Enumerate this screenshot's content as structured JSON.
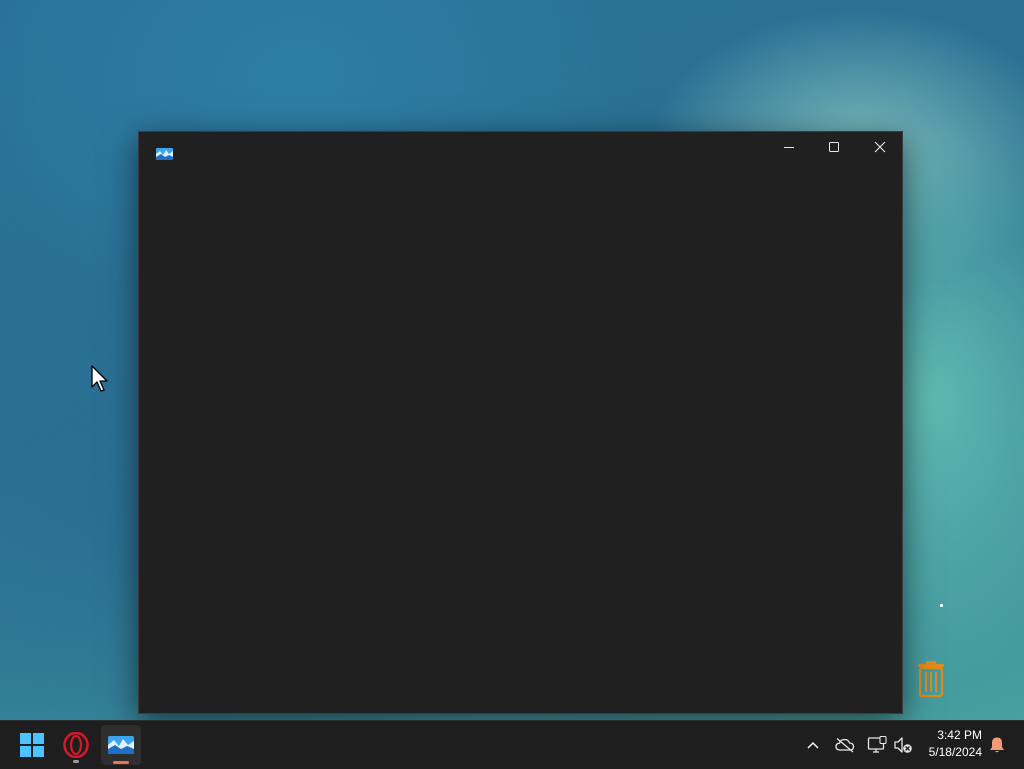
{
  "window": {
    "title": "",
    "app_icon": "photos-app-icon",
    "controls": {
      "minimize_icon": "minimize-icon",
      "maximize_icon": "maximize-icon",
      "close_icon": "close-icon"
    },
    "background": "#202020"
  },
  "desktop": {
    "icons": [
      "recycle-bin-icon"
    ]
  },
  "taskbar": {
    "pinned": [
      {
        "name": "start-button",
        "icon": "windows-logo-icon"
      },
      {
        "name": "opera-browser",
        "icon": "opera-icon"
      },
      {
        "name": "photos-app",
        "icon": "photos-app-icon",
        "active": true
      }
    ],
    "tray_icons": [
      "chevron-up-icon",
      "cloud-off-icon",
      "network-icon",
      "volume-muted-icon",
      "notification-bell-icon"
    ],
    "clock": {
      "time": "3:42 PM",
      "date": "5/18/2024"
    },
    "accent": "#e8764b"
  }
}
